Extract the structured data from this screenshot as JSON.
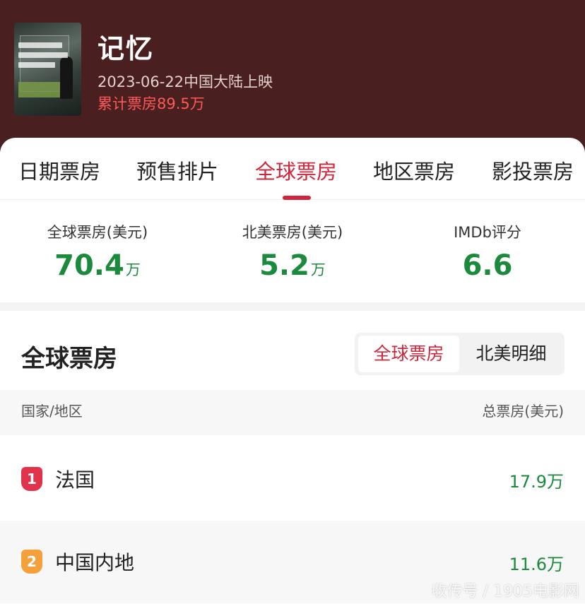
{
  "movie": {
    "title": "记忆",
    "release": "2023-06-22中国大陆上映",
    "cumulative": "累计票房89.5万"
  },
  "tabs": [
    {
      "label": "日期票房"
    },
    {
      "label": "预售排片"
    },
    {
      "label": "全球票房"
    },
    {
      "label": "地区票房"
    },
    {
      "label": "影投票房"
    }
  ],
  "active_tab": "全球票房",
  "stats": [
    {
      "label": "全球票房(美元)",
      "value": "70.4",
      "unit": "万"
    },
    {
      "label": "北美票房(美元)",
      "value": "5.2",
      "unit": "万"
    },
    {
      "label": "IMDb评分",
      "value": "6.6",
      "unit": ""
    }
  ],
  "section": {
    "title": "全球票房",
    "segment": {
      "active": "全球票房",
      "inactive": "北美明细"
    }
  },
  "table": {
    "col_left": "国家/地区",
    "col_right": "总票房(美元)",
    "rows": [
      {
        "rank": "1",
        "name": "法国",
        "value": "17.9万",
        "badge_color": "#e0324a"
      },
      {
        "rank": "2",
        "name": "中国内地",
        "value": "11.6万",
        "badge_color": "#f5a03a"
      }
    ]
  },
  "colors": {
    "accent": "#d0263c",
    "value_green": "#1c8a3c",
    "header_bg": "#4a1f1f"
  },
  "watermark": "收传号 / 1905电影网"
}
